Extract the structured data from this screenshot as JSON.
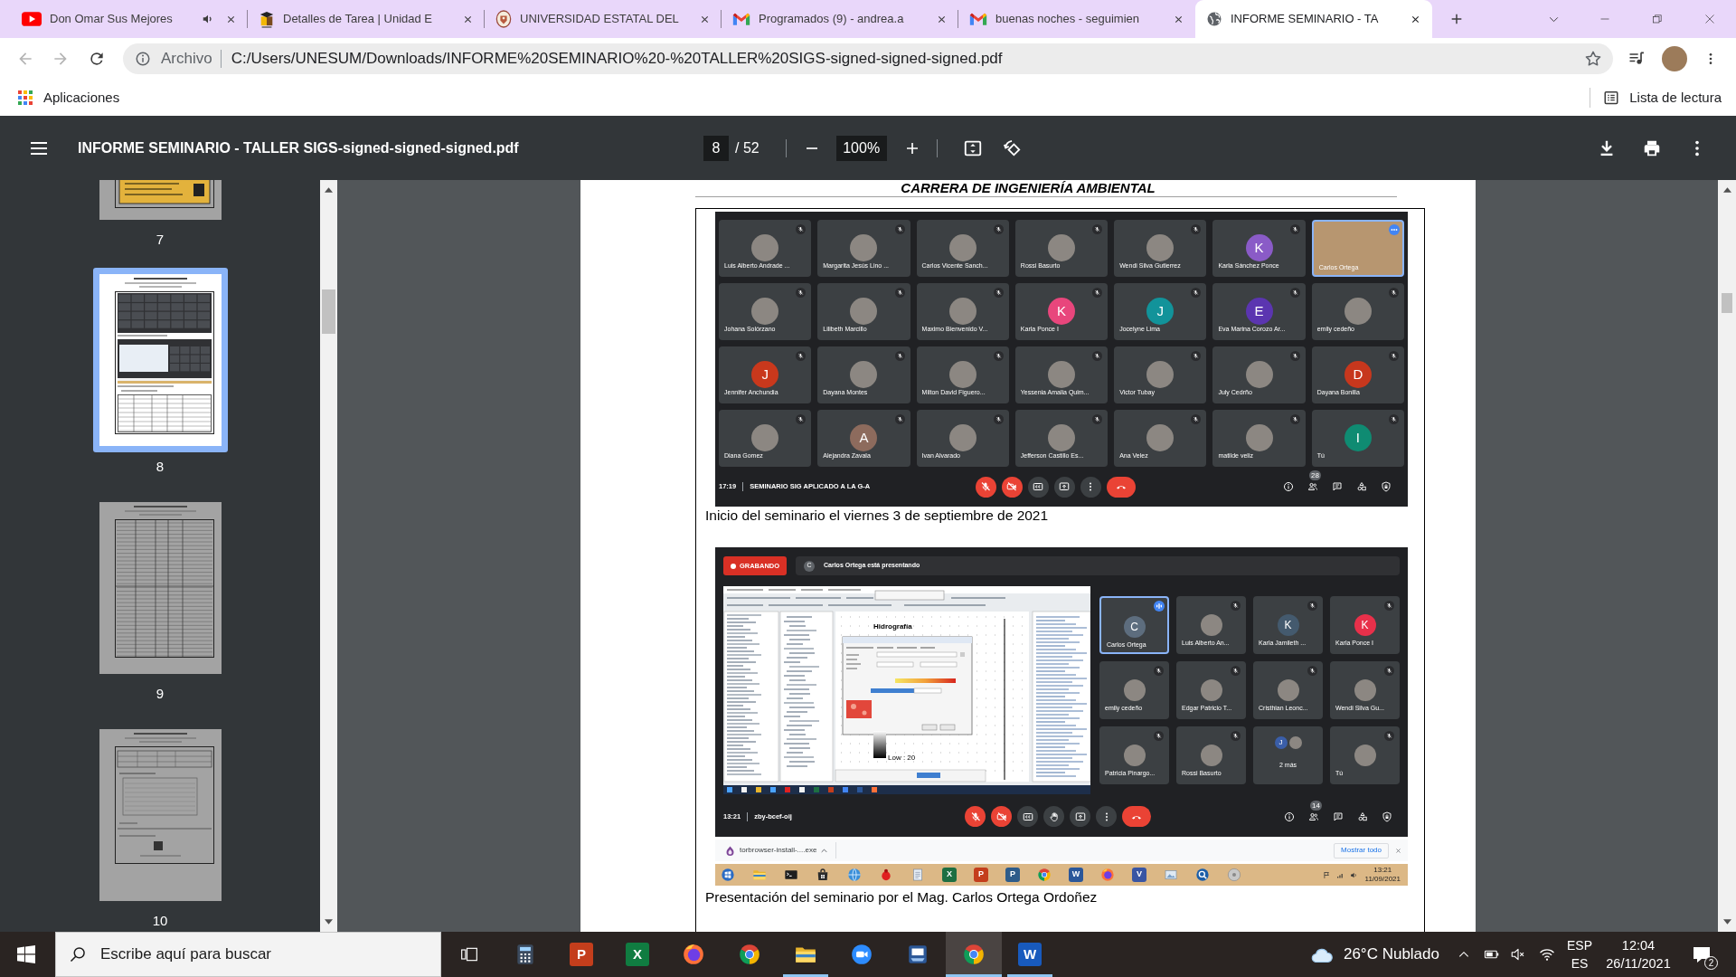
{
  "browser": {
    "tabs": [
      {
        "title": "Don Omar Sus Mejores",
        "kind": "video",
        "audio": true,
        "selected": false
      },
      {
        "title": "Detalles de Tarea | Unidad E",
        "kind": "course",
        "audio": false,
        "selected": false
      },
      {
        "title": "UNIVERSIDAD ESTATAL DEL",
        "kind": "crest",
        "audio": false,
        "selected": false
      },
      {
        "title": "Programados (9) - andrea.a",
        "kind": "mail",
        "audio": false,
        "selected": false
      },
      {
        "title": "buenas noches - seguimien",
        "kind": "mail",
        "audio": false,
        "selected": false
      },
      {
        "title": "INFORME SEMINARIO - TA",
        "kind": "web",
        "audio": false,
        "selected": true
      }
    ],
    "omnibox": {
      "scheme": "Archivo",
      "url": "C:/Users/UNESUM/Downloads/INFORME%20SEMINARIO%20-%20TALLER%20SIGS-signed-signed-signed.pdf"
    },
    "bookmarks": [
      {
        "label": "Aplicaciones"
      }
    ],
    "reading_list": "Lista de lectura"
  },
  "pdf_viewer": {
    "file_name": "INFORME SEMINARIO - TALLER SIGS-signed-signed-signed.pdf",
    "page": "8",
    "page_total": "/ 52",
    "zoom": "100%",
    "thumbnails": [
      {
        "page": "7",
        "kind": "flyer",
        "selected": false
      },
      {
        "page": "8",
        "kind": "photos",
        "selected": true
      },
      {
        "page": "9",
        "kind": "table",
        "selected": false
      },
      {
        "page": "10",
        "kind": "form",
        "selected": false
      }
    ],
    "document": {
      "header": "CARRERA DE INGENIERÍA AMBIENTAL",
      "figures": [
        {
          "kind": "meeting_grid",
          "meeting": {
            "tiles": [
              {
                "name": "Luis Alberto Andrade ...",
                "avatar": {
                  "kind": "photo"
                },
                "muted": true,
                "speaking": false,
                "hovered": false
              },
              {
                "name": "Margarita Jesús Lino ...",
                "avatar": {
                  "kind": "photo"
                },
                "muted": true,
                "speaking": false,
                "hovered": false
              },
              {
                "name": "Carlos Vicente Sanch...",
                "avatar": {
                  "kind": "photo"
                },
                "muted": true,
                "speaking": false,
                "hovered": false
              },
              {
                "name": "Rossi Basurto",
                "avatar": {
                  "kind": "photo"
                },
                "muted": true,
                "speaking": false,
                "hovered": false
              },
              {
                "name": "Wendi Silva Gutierrez",
                "avatar": {
                  "kind": "photo"
                },
                "muted": true,
                "speaking": false,
                "hovered": false
              },
              {
                "name": "Karla Sánchez Ponce",
                "avatar": {
                  "kind": "initial",
                  "initial": "K",
                  "color": "#8a5bc7"
                },
                "muted": true,
                "speaking": false,
                "hovered": false
              },
              {
                "name": "Carlos Ortega",
                "avatar": {
                  "kind": "video"
                },
                "muted": false,
                "speaking": true,
                "hovered": true
              },
              {
                "name": "Johana Solórzano",
                "avatar": {
                  "kind": "photo"
                },
                "muted": true,
                "speaking": false,
                "hovered": false
              },
              {
                "name": "Lilibeth Marcillo",
                "avatar": {
                  "kind": "photo"
                },
                "muted": true,
                "speaking": false,
                "hovered": false
              },
              {
                "name": "Maximo Bienvenido V...",
                "avatar": {
                  "kind": "photo"
                },
                "muted": true,
                "speaking": false,
                "hovered": false
              },
              {
                "name": "Karla Ponce I",
                "avatar": {
                  "kind": "initial",
                  "initial": "K",
                  "color": "#e8467c"
                },
                "muted": true,
                "speaking": false,
                "hovered": false
              },
              {
                "name": "Jocelyne Lima",
                "avatar": {
                  "kind": "initial",
                  "initial": "J",
                  "color": "#12939a"
                },
                "muted": true,
                "speaking": false,
                "hovered": false
              },
              {
                "name": "Eva Marina Corozo Ar...",
                "avatar": {
                  "kind": "initial",
                  "initial": "E",
                  "color": "#5b35b0"
                },
                "muted": true,
                "speaking": false,
                "hovered": false
              },
              {
                "name": "emily cedeño",
                "avatar": {
                  "kind": "photo"
                },
                "muted": true,
                "speaking": false,
                "hovered": false
              },
              {
                "name": "Jennifer Anchundia",
                "avatar": {
                  "kind": "initial",
                  "initial": "J",
                  "color": "#c9381c"
                },
                "muted": true,
                "speaking": false,
                "hovered": false
              },
              {
                "name": "Dayana Montes",
                "avatar": {
                  "kind": "photo"
                },
                "muted": true,
                "speaking": false,
                "hovered": false
              },
              {
                "name": "Milton David Figuero...",
                "avatar": {
                  "kind": "photo"
                },
                "muted": true,
                "speaking": false,
                "hovered": false
              },
              {
                "name": "Yessenia Amalia Quim...",
                "avatar": {
                  "kind": "photo"
                },
                "muted": true,
                "speaking": false,
                "hovered": false
              },
              {
                "name": "Victor Tubay",
                "avatar": {
                  "kind": "photo"
                },
                "muted": true,
                "speaking": false,
                "hovered": false
              },
              {
                "name": "July Cedrño",
                "avatar": {
                  "kind": "photo"
                },
                "muted": true,
                "speaking": false,
                "hovered": false
              },
              {
                "name": "Dayana Bonilla",
                "avatar": {
                  "kind": "initial",
                  "initial": "D",
                  "color": "#c7371d"
                },
                "muted": true,
                "speaking": false,
                "hovered": false
              },
              {
                "name": "Diana Gomez",
                "avatar": {
                  "kind": "photo"
                },
                "muted": true,
                "speaking": false,
                "hovered": false
              },
              {
                "name": "Alejandra Zavala",
                "avatar": {
                  "kind": "initial",
                  "initial": "A",
                  "color": "#8d6b5d"
                },
                "muted": true,
                "speaking": false,
                "hovered": false
              },
              {
                "name": "Ivan Alvarado",
                "avatar": {
                  "kind": "photo"
                },
                "muted": true,
                "speaking": false,
                "hovered": false
              },
              {
                "name": "Jefferson Castillo Es...",
                "avatar": {
                  "kind": "photo"
                },
                "muted": true,
                "speaking": false,
                "hovered": false
              },
              {
                "name": "Ana Velez",
                "avatar": {
                  "kind": "photo"
                },
                "muted": true,
                "speaking": false,
                "hovered": false
              },
              {
                "name": "matilde veliz",
                "avatar": {
                  "kind": "photo"
                },
                "muted": true,
                "speaking": false,
                "hovered": false
              },
              {
                "name": "Tú",
                "avatar": {
                  "kind": "initial",
                  "initial": "I",
                  "color": "#0f8b72"
                },
                "muted": true,
                "speaking": false,
                "hovered": false
              }
            ],
            "time": "17:19",
            "title": "SEMINARIO SIG APLICADO A LA G-A",
            "controls": [
              {
                "kind": "mic",
                "off": true
              },
              {
                "kind": "camera",
                "off": true
              },
              {
                "kind": "captions",
                "off": false
              },
              {
                "kind": "present",
                "off": false
              },
              {
                "kind": "more",
                "off": false
              },
              {
                "kind": "hangup",
                "off": false
              }
            ],
            "people_count": "28"
          },
          "caption": "Inicio del seminario el viernes 3 de septiembre de 2021"
        },
        {
          "kind": "meeting_presentation",
          "meeting": {
            "recording": "GRABANDO",
            "presenter": {
              "initial": "C",
              "text": "Carlos Ortega está presentando"
            },
            "shared_screen": {
              "heading": "Hidrografía",
              "legend": "Low : 20"
            },
            "tiles": [
              {
                "name": "Carlos Ortega",
                "avatar": {
                  "kind": "initial",
                  "initial": "C",
                  "color": "#5d6d7e"
                },
                "muted": false,
                "speaking": true,
                "hovered": false
              },
              {
                "name": "Luis Alberto An...",
                "avatar": {
                  "kind": "photo"
                },
                "muted": true,
                "speaking": false,
                "hovered": false
              },
              {
                "name": "Karla Jamileth ...",
                "avatar": {
                  "kind": "initial",
                  "initial": "K",
                  "color": "#445a6e"
                },
                "muted": true,
                "speaking": false,
                "hovered": false
              },
              {
                "name": "Karla Ponce I",
                "avatar": {
                  "kind": "initial",
                  "initial": "K",
                  "color": "#e8304a"
                },
                "muted": true,
                "speaking": false,
                "hovered": false
              },
              {
                "name": "emily cedeño",
                "avatar": {
                  "kind": "photo"
                },
                "muted": true,
                "speaking": false,
                "hovered": false
              },
              {
                "name": "Edgar Patricio T...",
                "avatar": {
                  "kind": "photo"
                },
                "muted": true,
                "speaking": false,
                "hovered": false
              },
              {
                "name": "Cristhian Leonc...",
                "avatar": {
                  "kind": "photo"
                },
                "muted": true,
                "speaking": false,
                "hovered": false
              },
              {
                "name": "Wendi Silva Gu...",
                "avatar": {
                  "kind": "photo"
                },
                "muted": true,
                "speaking": false,
                "hovered": false
              },
              {
                "name": "Patricia Pinargo...",
                "avatar": {
                  "kind": "photo"
                },
                "muted": true,
                "speaking": false,
                "hovered": false
              },
              {
                "name": "Rossi Basurto",
                "avatar": {
                  "kind": "photo"
                },
                "muted": true,
                "speaking": false,
                "hovered": false
              },
              {
                "name": "2 más",
                "avatar": {
                  "kind": "group",
                  "members": [
                    {
                      "kind": "initial",
                      "initial": "J",
                      "color": "#3a5ea8"
                    },
                    {
                      "kind": "photo"
                    }
                  ]
                },
                "muted": false,
                "speaking": false,
                "hovered": false
              },
              {
                "name": "Tú",
                "avatar": {
                  "kind": "photo"
                },
                "muted": true,
                "speaking": false,
                "hovered": false
              }
            ],
            "time": "13:21",
            "title": "zby-bcef-oij",
            "controls": [
              {
                "kind": "mic",
                "off": true
              },
              {
                "kind": "camera",
                "off": true
              },
              {
                "kind": "captions",
                "off": false
              },
              {
                "kind": "hand",
                "off": false
              },
              {
                "kind": "present",
                "off": false
              },
              {
                "kind": "more",
                "off": false
              },
              {
                "kind": "hangup",
                "off": false
              }
            ],
            "people_count": "14"
          },
          "download_bar": {
            "file": "torbrowser-install-....exe",
            "show_all": "Mostrar todo"
          },
          "os_taskbar": {
            "apps": [
              {
                "kind": "start"
              },
              {
                "kind": "files"
              },
              {
                "kind": "terminal"
              },
              {
                "kind": "store"
              },
              {
                "kind": "globe"
              },
              {
                "kind": "bug"
              },
              {
                "kind": "notepad"
              },
              {
                "kind": "tile",
                "label": "X",
                "color": "#1d6f42"
              },
              {
                "kind": "tile",
                "label": "P",
                "color": "#c43e1c"
              },
              {
                "kind": "tile",
                "label": "P",
                "color": "#2e5c8a"
              },
              {
                "kind": "chrome"
              },
              {
                "kind": "tile",
                "label": "W",
                "color": "#2b579a"
              },
              {
                "kind": "firefox"
              },
              {
                "kind": "tile",
                "label": "V",
                "color": "#3955a3"
              },
              {
                "kind": "photos"
              },
              {
                "kind": "search"
              },
              {
                "kind": "disc"
              }
            ],
            "time": "13:21",
            "date": "11/09/2021"
          },
          "caption": "Presentación del seminario por el Mag. Carlos Ortega Ordoñez"
        }
      ]
    }
  },
  "taskbar": {
    "search": {
      "placeholder": "Escribe aquí para buscar"
    },
    "apps": [
      {
        "kind": "calculator",
        "running": false,
        "selected": false
      },
      {
        "kind": "tile",
        "label": "P",
        "color": "#c43e1c",
        "running": false,
        "selected": false
      },
      {
        "kind": "tile",
        "label": "X",
        "color": "#107c41",
        "running": false,
        "selected": false
      },
      {
        "kind": "firefox",
        "running": false,
        "selected": false
      },
      {
        "kind": "chrome",
        "running": false,
        "selected": false
      },
      {
        "kind": "files",
        "running": true,
        "selected": false
      },
      {
        "kind": "zoom",
        "running": false,
        "selected": false
      },
      {
        "kind": "scanner",
        "running": false,
        "selected": false
      },
      {
        "kind": "chrome",
        "running": true,
        "selected": true
      },
      {
        "kind": "tile",
        "label": "W",
        "color": "#185abd",
        "running": true,
        "selected": false
      }
    ],
    "weather": "26°C Nublado",
    "language": "ESP",
    "layout": "ES",
    "time": "12:04",
    "date": "26/11/2021",
    "notifications": "2"
  }
}
